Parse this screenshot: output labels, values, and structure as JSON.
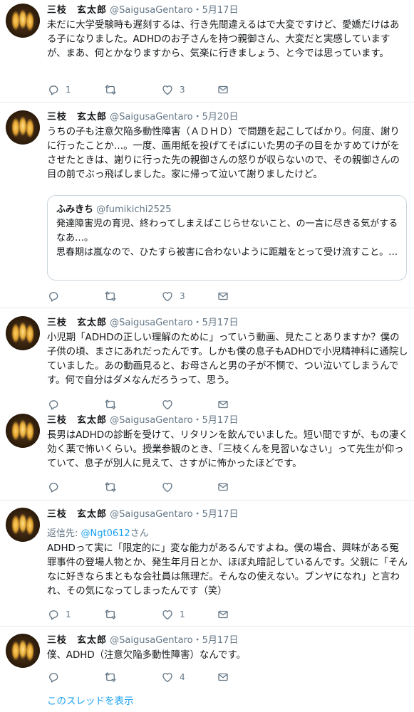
{
  "tweets": [
    {
      "name": "三枝　玄太郎",
      "handle": "@SaigusaGentaro",
      "dot": "・",
      "date": "5月17日",
      "text": "未だに大学受験時も遅刻するは、行き先間違えるはで大変ですけど、愛嬌だけはある子になりました。ADHDのお子さんを持つ親御さん、大変だと実感していますが、まあ、何とかなりますから、気楽に行きましょう、と今では思っています。",
      "reply_count": "1",
      "retweet_count": "",
      "like_count": "3"
    },
    {
      "name": "三枝　玄太郎",
      "handle": "@SaigusaGentaro",
      "dot": "・",
      "date": "5月20日",
      "text": "うちの子も注意欠陥多動性障害（ＡＤＨＤ）で問題を起こしてばかり。何度、謝りに行ったことか…。一度、画用紙を投げてそばにいた男の子の目をかすめてけがをさせたときは、謝りに行った先の親御さんの怒りが収らないので、その親御さんの目の前でぶっ飛ばしました。家に帰って泣いて謝りましたけど。",
      "quote": {
        "name": "ふみきち",
        "handle": "@fumikichi2525",
        "text": "発達障害児の育児、終わってしまえばこじらせないこと、の一言に尽きる気がするなあ…。\n思春期は嵐なので、ひたすら被害に合わないように距離をとって受け流すこと。…"
      },
      "reply_count": "",
      "retweet_count": "",
      "like_count": "3"
    },
    {
      "name": "三枝　玄太郎",
      "handle": "@SaigusaGentaro",
      "dot": "・",
      "date": "5月17日",
      "text": "小児期「ADHDの正しい理解のために」っていう動画、見たことありますか？僕の子供の頃、まさにあれだったんです。しかも僕の息子もADHDで小児精神科に通院していました。あの動画見ると、お母さんと男の子が不憫で、つい泣いてしまうんです。何で自分はダメなんだろうって、思う。",
      "reply_count": "",
      "retweet_count": "",
      "like_count": ""
    },
    {
      "name": "三枝　玄太郎",
      "handle": "@SaigusaGentaro",
      "dot": "・",
      "date": "5月17日",
      "text": "長男はADHDの診断を受けて、リタリンを飲んでいました。短い間ですが、もの凄く効く薬で怖いくらい。授業参観のとき、「三枝くんを見習いなさい」って先生が仰っていて、息子が別人に見えて、さすがに怖かったほどです。",
      "reply_count": "",
      "retweet_count": "",
      "like_count": ""
    },
    {
      "name": "三枝　玄太郎",
      "handle": "@SaigusaGentaro",
      "dot": "・",
      "date": "5月17日",
      "reply_label": "返信先: ",
      "reply_mention": "@Ngt0612",
      "reply_suffix": "さん",
      "text": "ADHDって実に「限定的に」変な能力があるんですよね。僕の場合、興味がある冤罪事件の登場人物とか、発生年月日とか、ほぼ丸暗記しているんです。父親に「そんなに好きならまともな会社員は無理だ。そんなの使えない。ブンヤになれ」と言われ、その気になってしまったんです（笑）",
      "reply_count": "1",
      "retweet_count": "",
      "like_count": "1"
    },
    {
      "name": "三枝　玄太郎",
      "handle": "@SaigusaGentaro",
      "dot": "・",
      "date": "5月17日",
      "text": "僕、ADHD（注意欠陥多動性障害）なんです。",
      "reply_count": "",
      "retweet_count": "",
      "like_count": "4"
    }
  ],
  "show_thread": "このスレッドを表示",
  "icons": {
    "reply": "reply-icon",
    "retweet": "retweet-icon",
    "like": "heart-icon",
    "dm": "envelope-icon"
  },
  "colors": {
    "text": "#14171a",
    "secondary": "#657786",
    "link": "#1da1f2",
    "divider": "#e6ecf0"
  }
}
